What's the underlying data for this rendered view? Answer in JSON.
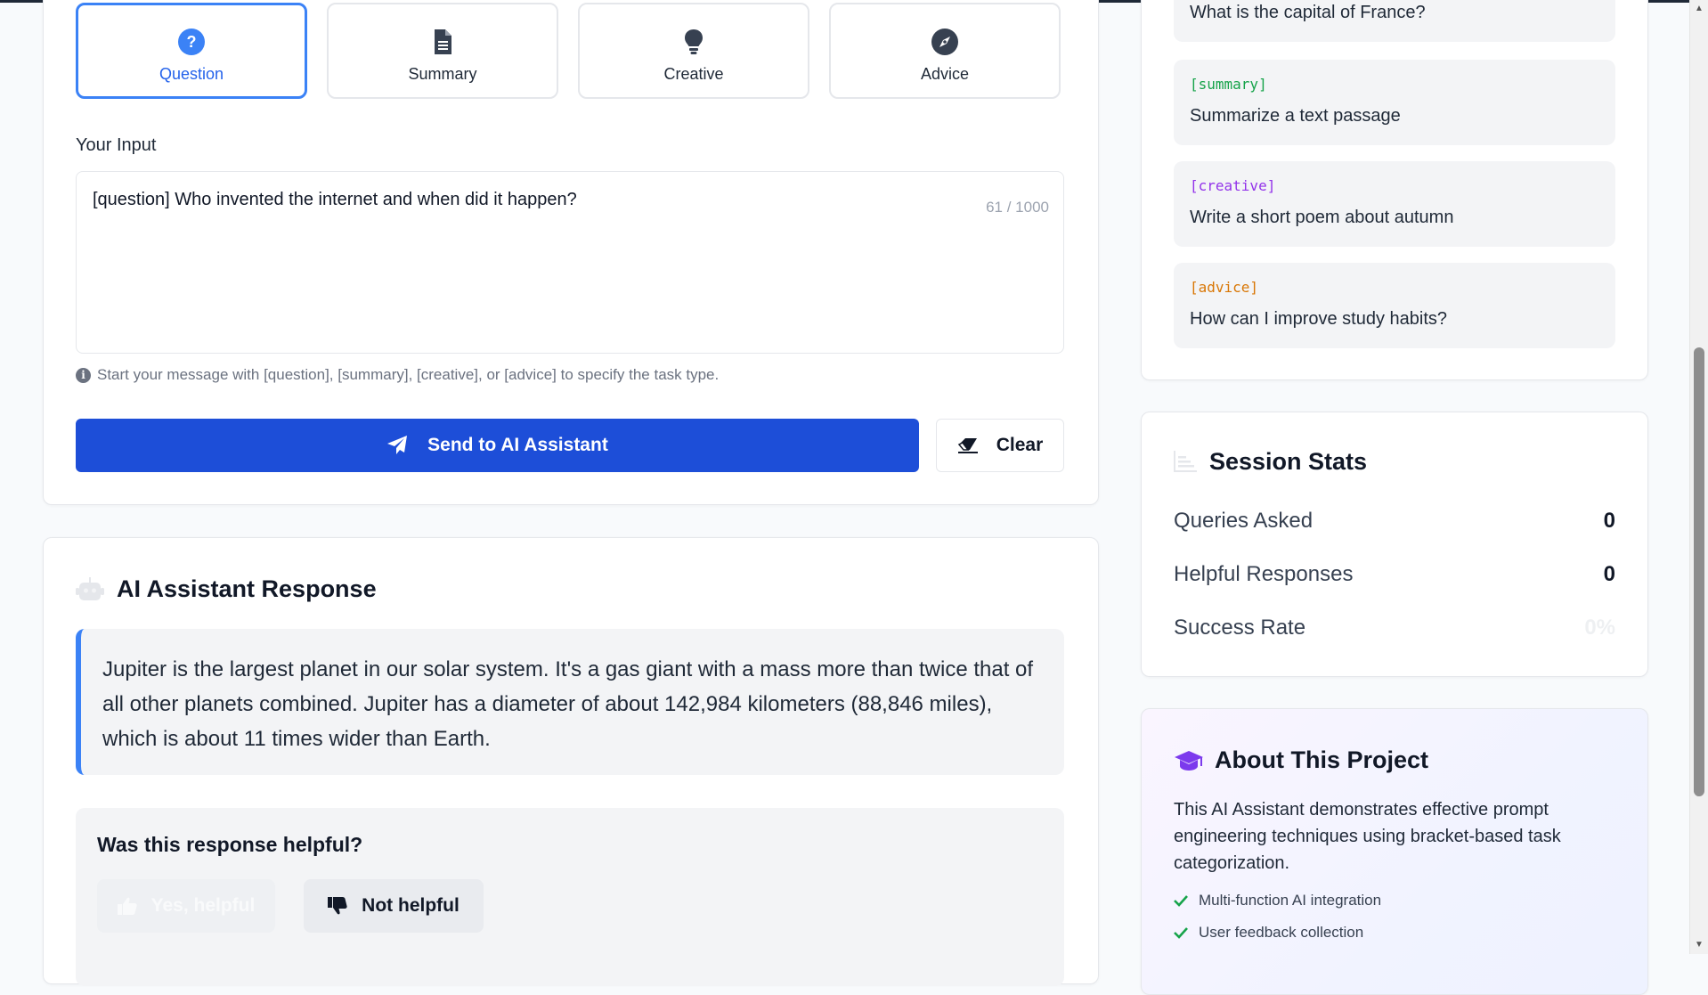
{
  "task_buttons": [
    {
      "label": "Question",
      "icon": "question-circle-icon",
      "active": true
    },
    {
      "label": "Summary",
      "icon": "document-icon",
      "active": false
    },
    {
      "label": "Creative",
      "icon": "lightbulb-icon",
      "active": false
    },
    {
      "label": "Advice",
      "icon": "compass-icon",
      "active": false
    }
  ],
  "input": {
    "label": "Your Input",
    "value": "[question] Who invented the internet and when did it happen?",
    "counter": "61 / 1000",
    "hint": "Start your message with [question], [summary], [creative], or [advice] to specify the task type."
  },
  "actions": {
    "send_label": "Send to AI Assistant",
    "clear_label": "Clear"
  },
  "response": {
    "title": "AI Assistant Response",
    "text": "Jupiter is the largest planet in our solar system. It's a gas giant with a mass more than twice that of all other planets combined. Jupiter has a diameter of about 142,984 kilometers (88,846 miles), which is about 11 times wider than Earth."
  },
  "feedback": {
    "question": "Was this response helpful?",
    "yes_label": "Yes, helpful",
    "no_label": "Not helpful"
  },
  "examples": [
    {
      "tag": "",
      "text": "What is the capital of France?",
      "color": "#16a34a"
    },
    {
      "tag": "[summary]",
      "text": "Summarize a text passage",
      "color": "#16a34a"
    },
    {
      "tag": "[creative]",
      "text": "Write a short poem about autumn",
      "color": "#9333ea"
    },
    {
      "tag": "[advice]",
      "text": "How can I improve study habits?",
      "color": "#d97706"
    }
  ],
  "stats": {
    "title": "Session Stats",
    "rows": [
      {
        "label": "Queries Asked",
        "value": "0"
      },
      {
        "label": "Helpful Responses",
        "value": "0"
      },
      {
        "label": "Success Rate",
        "value": "0%"
      }
    ]
  },
  "about": {
    "title": "About This Project",
    "description": "This AI Assistant demonstrates effective prompt engineering techniques using bracket-based task categorization.",
    "features": [
      "Multi-function AI integration",
      "User feedback collection"
    ]
  },
  "colors": {
    "primary": "#1d4ed8",
    "accent_blue": "#3b82f6",
    "check_green": "#16a34a",
    "about_purple": "#7c3aed"
  }
}
